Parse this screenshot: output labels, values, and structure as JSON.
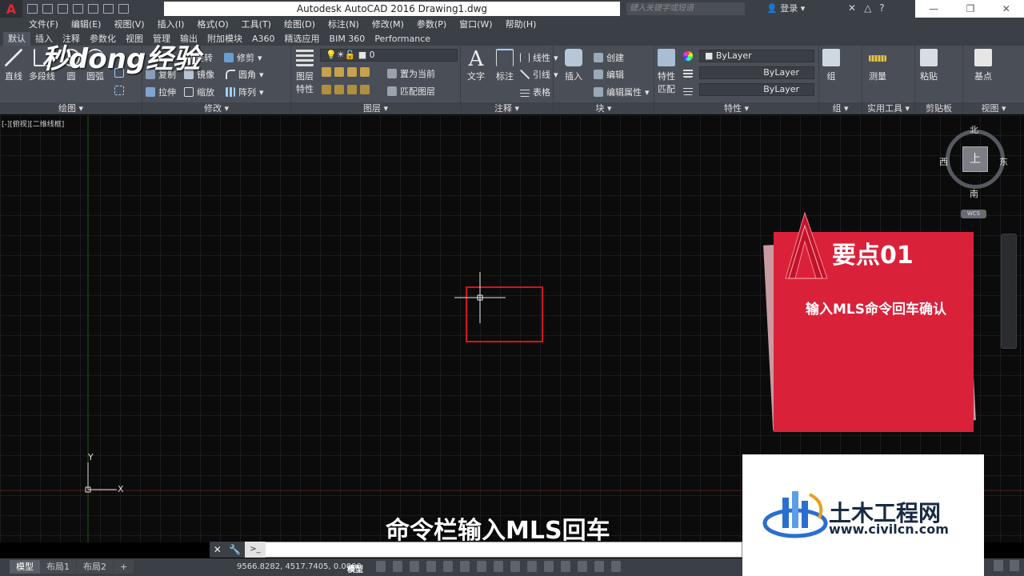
{
  "titlebar": {
    "app_logo": "A",
    "title": "Autodesk AutoCAD 2016    Drawing1.dwg",
    "search_placeholder": "键入关键字或短语",
    "signin_label": "登录"
  },
  "menu": [
    "文件(F)",
    "编辑(E)",
    "视图(V)",
    "插入(I)",
    "格式(O)",
    "工具(T)",
    "绘图(D)",
    "标注(N)",
    "修改(M)",
    "参数(P)",
    "窗口(W)",
    "帮助(H)"
  ],
  "ribbon_tabs": [
    "默认",
    "插入",
    "注释",
    "参数化",
    "视图",
    "管理",
    "输出",
    "附加模块",
    "A360",
    "精选应用",
    "BIM 360",
    "Performance"
  ],
  "ribbon": {
    "draw": {
      "title": "绘图",
      "line": "直线",
      "polyline": "多段线",
      "circle": "圆",
      "arc": "圆弧"
    },
    "modify": {
      "title": "修改",
      "rotate": "旋转",
      "trim": "修剪",
      "copy": "复制",
      "mirror": "镜像",
      "fillet": "圆角",
      "stretch": "拉伸",
      "scale": "缩放",
      "array": "阵列"
    },
    "layers": {
      "title": "图层",
      "layer_props_1": "图层",
      "layer_props_2": "特性",
      "current_layer": "0",
      "set_current": "置为当前",
      "match_layer": "匹配图层"
    },
    "annotation": {
      "title": "注释",
      "text": "文字",
      "dimension": "标注",
      "linear": "线性",
      "leader": "引线",
      "table": "表格"
    },
    "block": {
      "title": "块",
      "insert": "插入",
      "create": "创建",
      "edit": "编辑",
      "edit_attributes": "编辑属性"
    },
    "properties": {
      "title": "特性",
      "match_1": "特性",
      "match_2": "匹配",
      "color": "ByLayer",
      "linetype": "ByLayer",
      "lineweight": "ByLayer"
    },
    "groups": {
      "title": "组",
      "group": "组"
    },
    "utilities": {
      "title": "实用工具",
      "measure": "测量"
    },
    "clipboard": {
      "title": "剪贴板",
      "paste": "粘贴"
    },
    "view": {
      "title": "视图",
      "base": "基点"
    }
  },
  "viewport_label": "[-][俯视][二维线框]",
  "viewcube": {
    "face": "上",
    "north": "北",
    "south": "南",
    "east": "东",
    "west": "西",
    "wcs": "WCS"
  },
  "ucs": {
    "x": "X",
    "y": "Y"
  },
  "callout": {
    "title": "要点01",
    "text": "输入MLS命令回车确认"
  },
  "watermarks": {
    "top_left": "秒dong经验",
    "site_name": "土木工程网",
    "site_url": "www.civilcn.com"
  },
  "subtitle": "命令栏输入MLS回车",
  "command_line": {
    "prompt_icon": ">_",
    "value": ""
  },
  "status": {
    "tabs": [
      "模型",
      "布局1",
      "布局2"
    ],
    "add_tab": "+",
    "coordinates": "9566.8282, 4517.7405, 0.0000",
    "space": "模型"
  },
  "colors": {
    "accent_red": "#d9223a",
    "ribbon_bg": "#4a4f57",
    "titlebar_bg": "#3b3f46"
  }
}
